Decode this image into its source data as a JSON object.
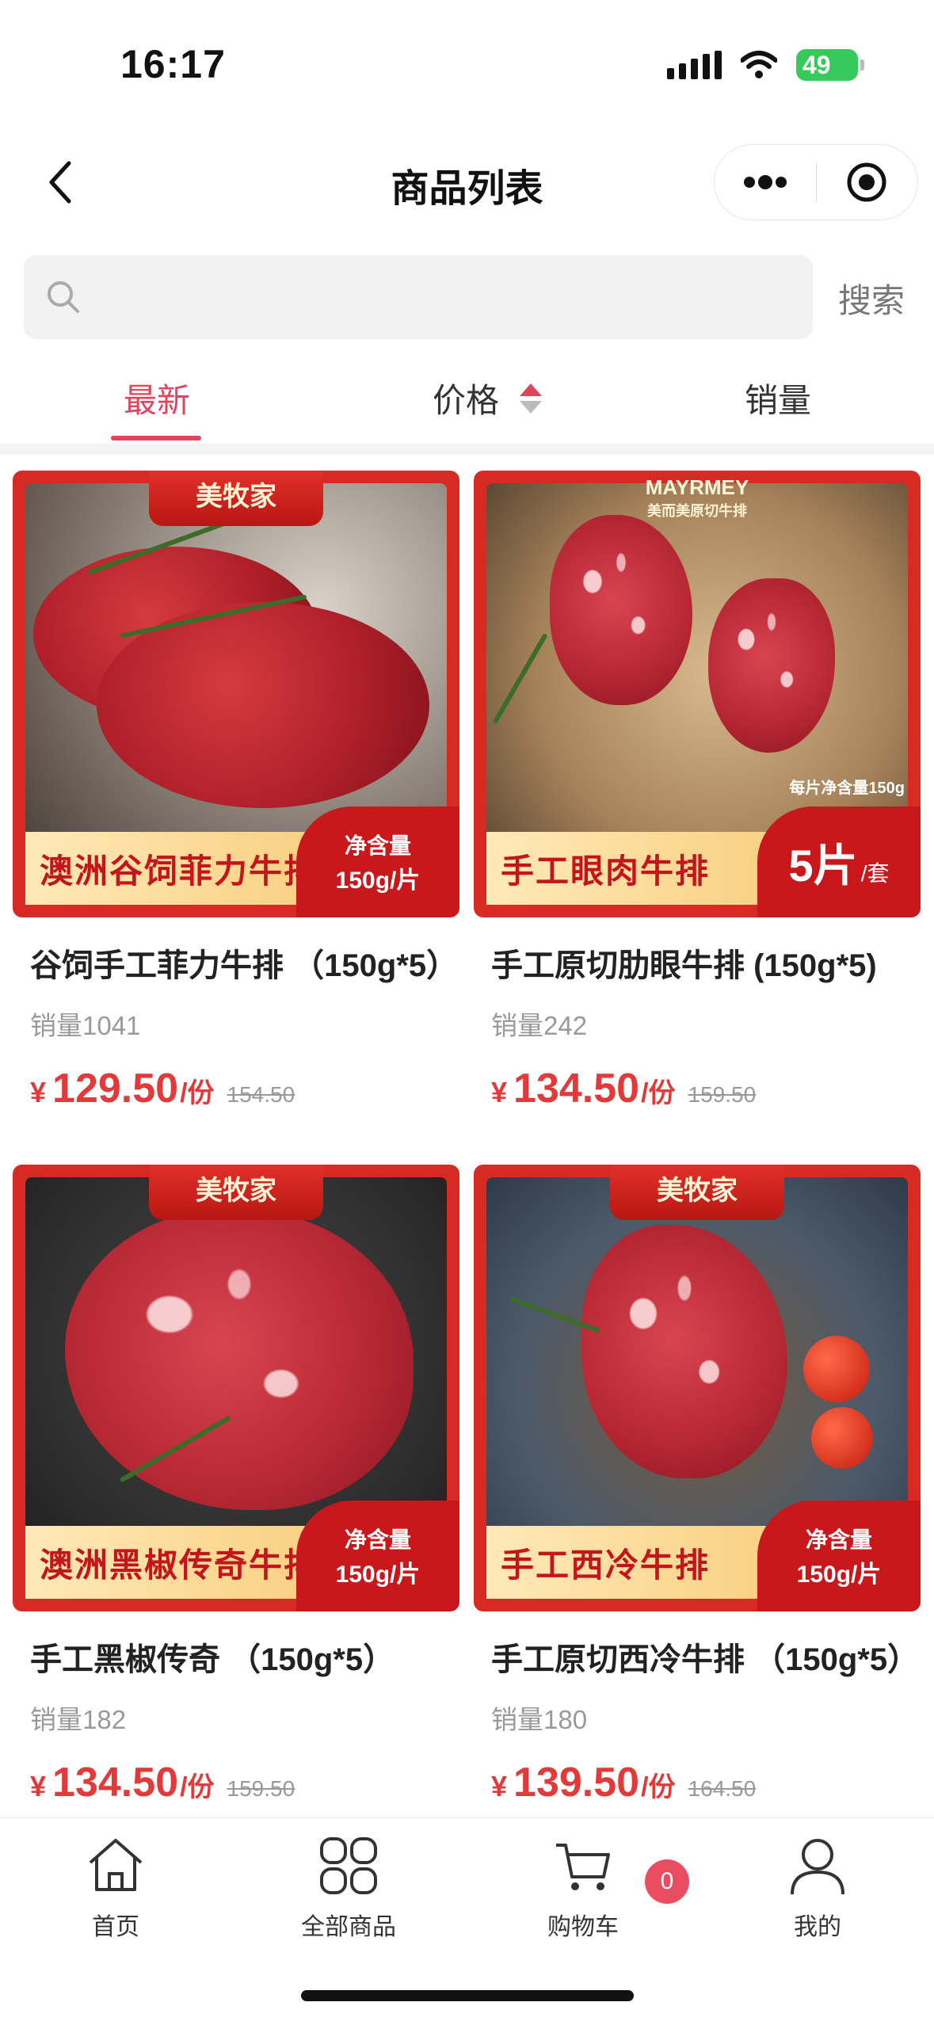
{
  "status_bar": {
    "time": "16:17",
    "battery": "49"
  },
  "nav": {
    "title": "商品列表"
  },
  "search": {
    "placeholder": "",
    "button_label": "搜索"
  },
  "sort_tabs": [
    {
      "label": "最新",
      "active": true
    },
    {
      "label": "价格",
      "active": false
    },
    {
      "label": "销量",
      "active": false
    }
  ],
  "products": [
    {
      "title": "谷饲手工菲力牛排 （150g*5）",
      "sales": "销量1041",
      "price": "129.50",
      "unit": "/份",
      "original_price": "154.50",
      "currency": "¥",
      "image": {
        "brand": "美牧家",
        "label": "澳洲谷饲菲力牛排",
        "badge_line1": "净含量",
        "badge_line2": "150g/片"
      }
    },
    {
      "title": "手工原切肋眼牛排 (150g*5)",
      "sales": "销量242",
      "price": "134.50",
      "unit": "/份",
      "original_price": "159.50",
      "currency": "¥",
      "image": {
        "brand": "MAYRMEY",
        "brand_sub": "美而美原切牛排",
        "label": "手工眼肉牛排",
        "badge_big": "5片",
        "badge_small": "/套",
        "note": "每片净含量150g"
      }
    },
    {
      "title": "手工黑椒传奇 （150g*5）",
      "sales": "销量182",
      "price": "134.50",
      "unit": "/份",
      "original_price": "159.50",
      "currency": "¥",
      "image": {
        "brand": "美牧家",
        "label": "澳洲黑椒传奇牛排",
        "badge_line1": "净含量",
        "badge_line2": "150g/片"
      }
    },
    {
      "title": "手工原切西冷牛排 （150g*5）",
      "sales": "销量180",
      "price": "139.50",
      "unit": "/份",
      "original_price": "164.50",
      "currency": "¥",
      "image": {
        "brand": "美牧家",
        "label": "手工西冷牛排",
        "badge_line1": "净含量",
        "badge_line2": "150g/片"
      }
    }
  ],
  "tabbar": {
    "items": [
      {
        "label": "首页",
        "icon": "home-icon"
      },
      {
        "label": "全部商品",
        "icon": "grid-icon"
      },
      {
        "label": "购物车",
        "icon": "cart-icon"
      },
      {
        "label": "我的",
        "icon": "user-icon"
      }
    ],
    "cart_count": "0"
  },
  "colors": {
    "accent": "#e0455d",
    "price": "#e23a3a",
    "image_red": "#d62a22"
  }
}
